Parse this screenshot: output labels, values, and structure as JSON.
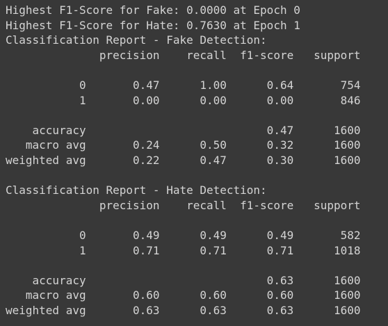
{
  "output_lines": [
    "Highest F1-Score for Fake: 0.0000 at Epoch 0",
    "Highest F1-Score for Hate: 0.7630 at Epoch 1",
    "Classification Report - Fake Detection:",
    "              precision    recall  f1-score   support",
    "",
    "           0       0.47      1.00      0.64       754",
    "           1       0.00      0.00      0.00       846",
    "",
    "    accuracy                           0.47      1600",
    "   macro avg       0.24      0.50      0.32      1600",
    "weighted avg       0.22      0.47      0.30      1600",
    "",
    "Classification Report - Hate Detection:",
    "              precision    recall  f1-score   support",
    "",
    "           0       0.49      0.49      0.49       582",
    "           1       0.71      0.71      0.71      1018",
    "",
    "    accuracy                           0.63      1600",
    "   macro avg       0.60      0.60      0.60      1600",
    "weighted avg       0.63      0.63      0.63      1600"
  ],
  "colors": {
    "background": "#383838",
    "text": "#d4d4d4"
  }
}
